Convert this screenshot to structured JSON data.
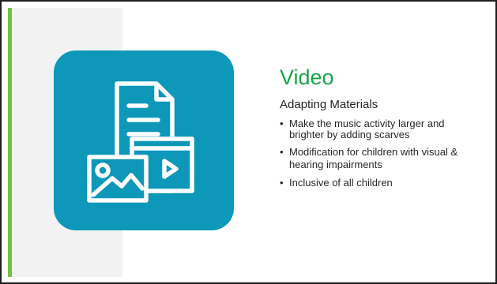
{
  "slide": {
    "title": "Video",
    "subtitle": "Adapting Materials",
    "bullets": [
      "Make the music activity larger and brighter by adding scarves",
      "Modification for children with visual & hearing impairments",
      "Inclusive of all children"
    ],
    "icon": "document-image-video-icon"
  },
  "colors": {
    "accent_bar": "#74c043",
    "title": "#19a44a",
    "icon_tile": "#0d97b9",
    "left_panel": "#f2f2f2"
  }
}
